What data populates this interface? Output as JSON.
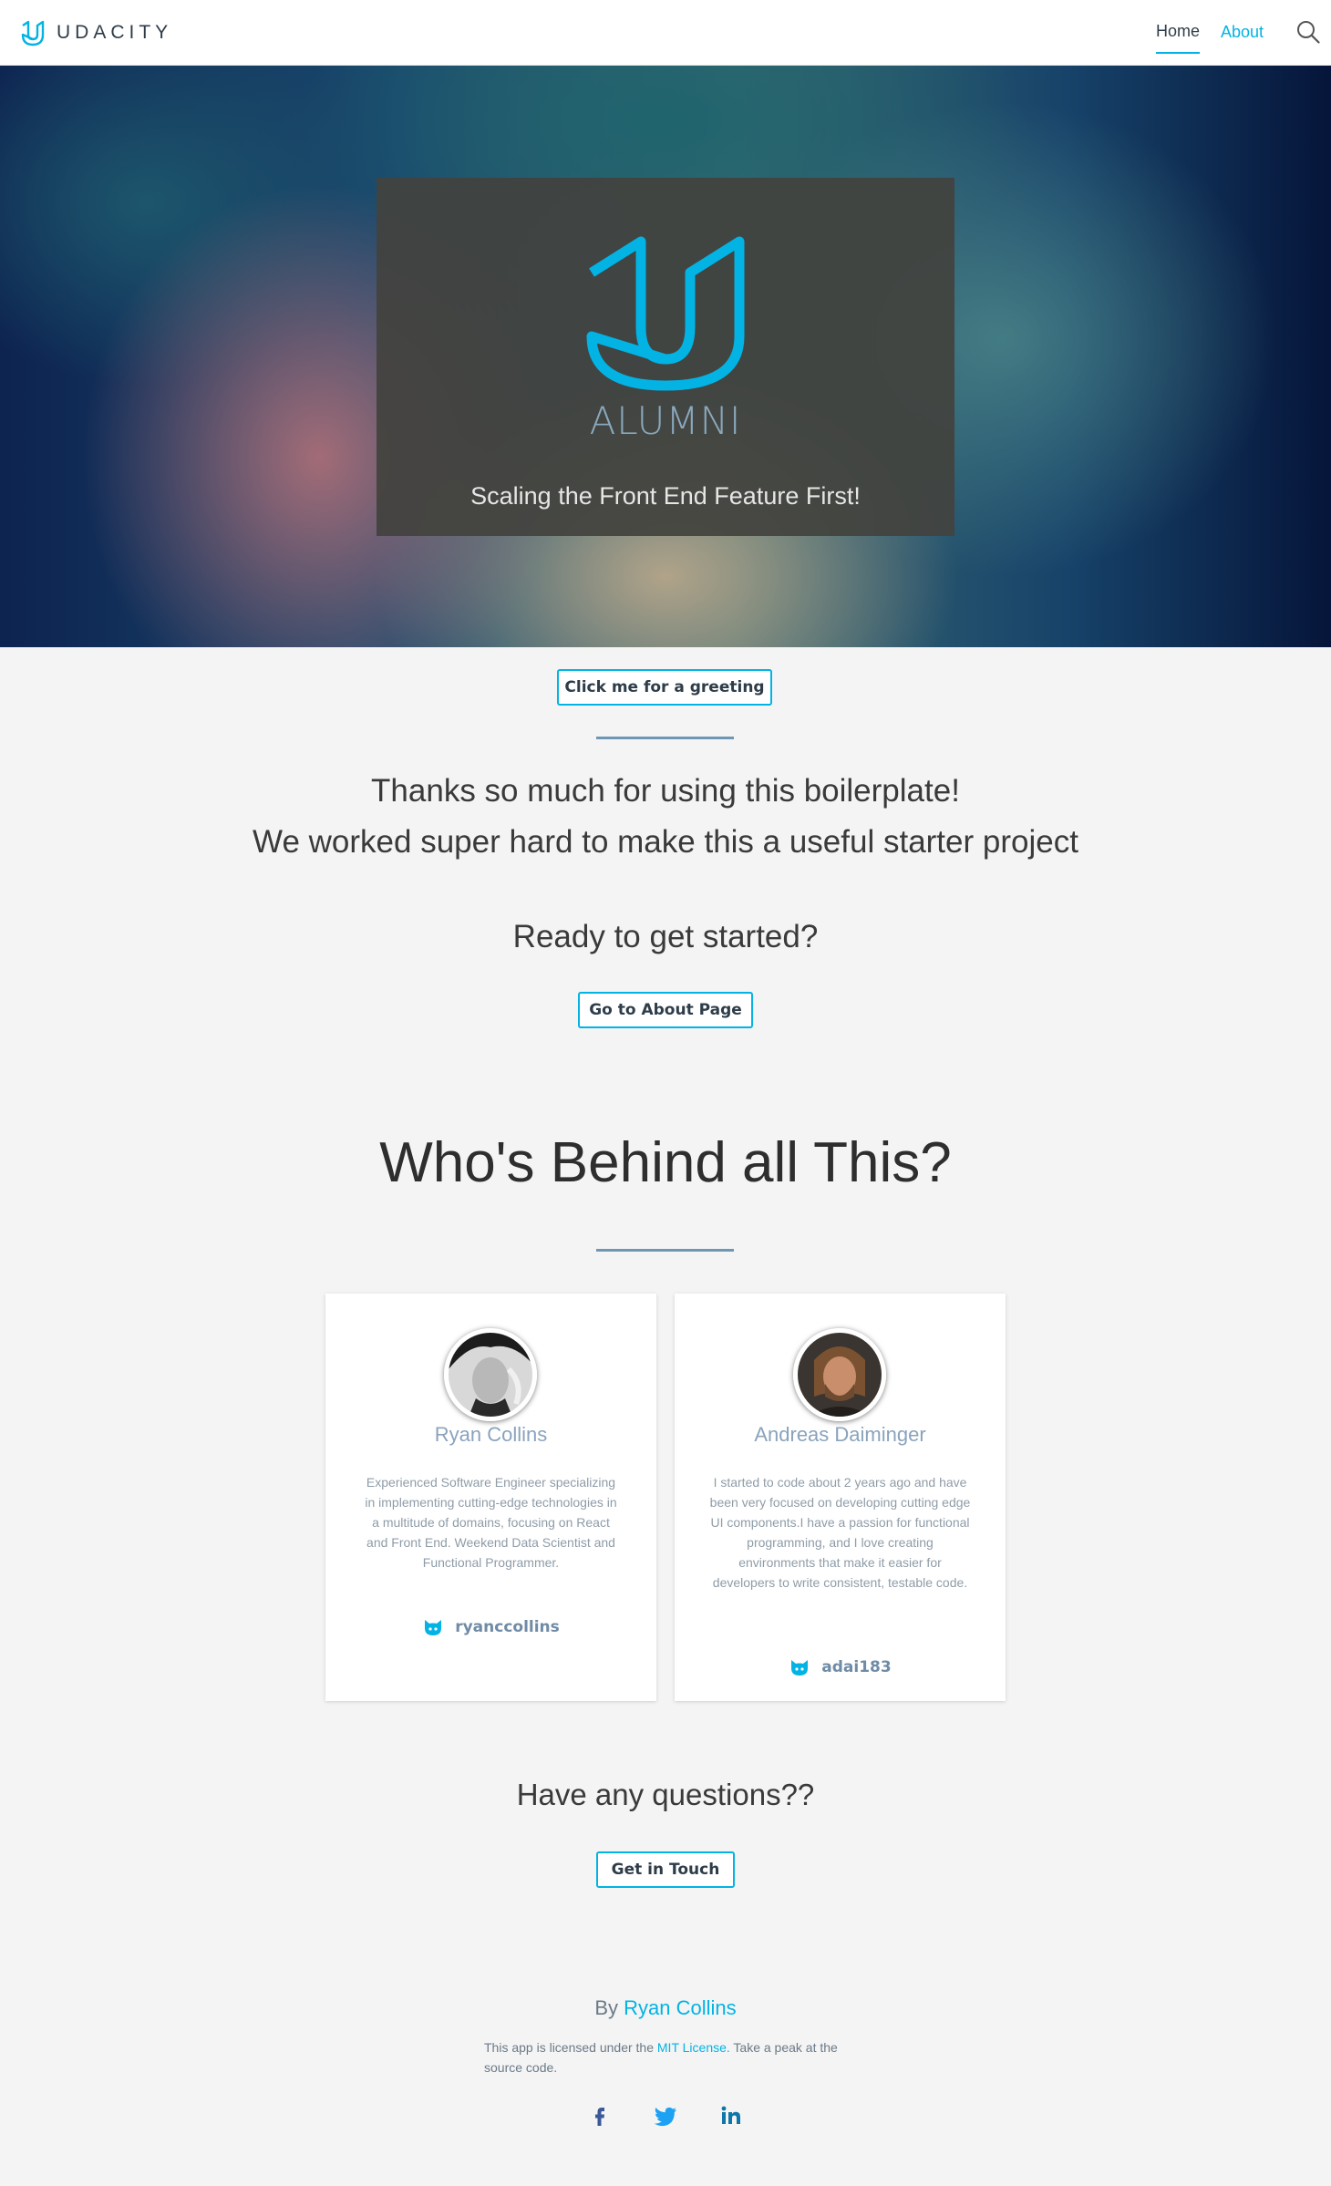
{
  "header": {
    "brand": "UDACITY",
    "nav": {
      "home": "Home",
      "about": "About"
    }
  },
  "hero": {
    "title": "ALUMNI",
    "tagline": "Scaling the Front End Feature First!"
  },
  "greeting_button": "Click me for a greeting",
  "intro": {
    "line1": "Thanks so much for using this boilerplate!",
    "line2": "We worked super hard to make this a useful starter project",
    "ready": "Ready to get started?",
    "about_button": "Go to About Page"
  },
  "team": {
    "heading": "Who's Behind all This?",
    "members": [
      {
        "name": "Ryan Collins",
        "bio": "Experienced Software Engineer specializing in implementing cutting-edge technologies in a multitude of domains, focusing on React and Front End. Weekend Data Scientist and Functional Programmer.",
        "github": "ryanccollins"
      },
      {
        "name": "Andreas Daiminger",
        "bio": "I started to code about 2 years ago and have been very focused on developing cutting edge UI components.I have a passion for functional programming, and I love creating environments that make it easier for developers to write consistent, testable code.",
        "github": "adai183"
      }
    ]
  },
  "contact": {
    "question": "Have any questions??",
    "button": "Get in Touch"
  },
  "footer": {
    "by_prefix": "By",
    "author": "Ryan Collins",
    "license_prefix": "This app is licensed under the",
    "license_link": "MIT License.",
    "license_suffix": "Take a peak at the source code."
  },
  "colors": {
    "accent": "#02b3e4",
    "divider": "#6e96b5",
    "facebook": "#3b5998",
    "twitter": "#1da1f2",
    "linkedin": "#0e76a8"
  },
  "icons": [
    "udacity-logo",
    "search-icon",
    "github-icon",
    "facebook-icon",
    "twitter-icon",
    "linkedin-icon"
  ]
}
